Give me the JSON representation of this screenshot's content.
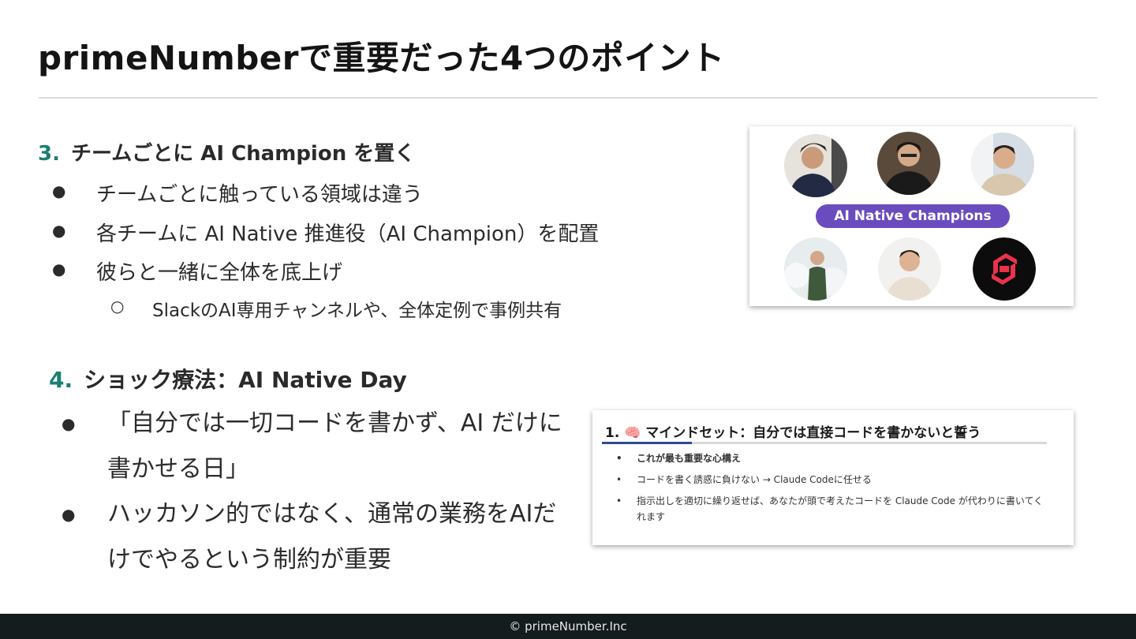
{
  "title": "primeNumberで重要だった4つのポイント",
  "section3": {
    "number": "3.",
    "heading": "チームごとに AI Champion を置く",
    "bullets": [
      "チームごとに触っている領域は違う",
      "各チームに AI Native 推進役（AI Champion）を配置",
      "彼らと一緒に全体を底上げ"
    ],
    "sub_bullet": "SlackのAI専用チャンネルや、全体定例で事例共有",
    "image_banner": "AI Native Champions"
  },
  "section4": {
    "number": "4.",
    "heading": "ショック療法：AI Native Day",
    "bullets": [
      "「自分では一切コードを書かず、AI だけに書かせる日」",
      "ハッカソン的ではなく、通常の業務をAIだけでやるという制約が重要"
    ],
    "doc": {
      "heading": "1. 🧠 マインドセット：自分では直接コードを書かないと誓う",
      "items": [
        "これが最も重要な心構え",
        "コードを書く誘惑に負けない → Claude Codeに任せる",
        "指示出しを適切に繰り返せば、あなたが頭で考えたコードを Claude Code が代わりに書いてくれます"
      ]
    }
  },
  "bullet_glyph": "●",
  "sub_bullet_glyph": "○",
  "doc_bullet_glyph": "•",
  "footer": "© primeNumber.Inc",
  "colors": {
    "accent": "#1a7f74",
    "banner": "#6a4cbf",
    "footer_bg": "#141c1e"
  }
}
